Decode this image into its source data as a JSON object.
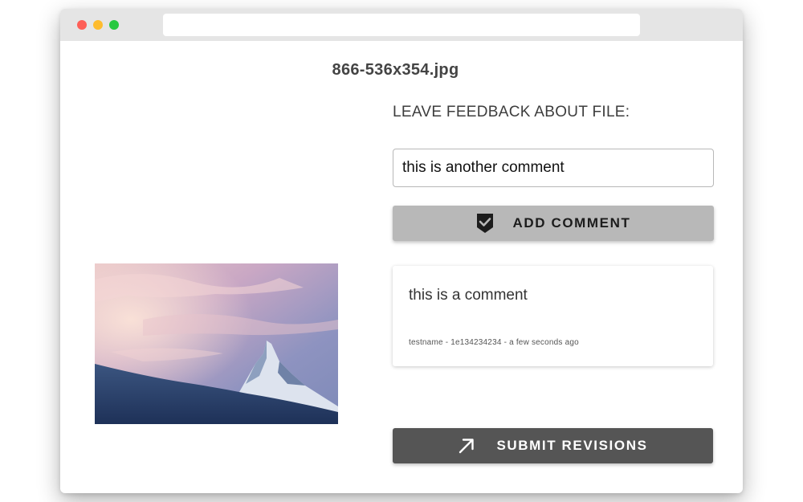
{
  "window": {
    "controls": [
      "close",
      "minimize",
      "zoom"
    ],
    "address_bar": ""
  },
  "file": {
    "title": "866-536x354.jpg",
    "preview_description": "mountain-peak-photo"
  },
  "feedback": {
    "label": "LEAVE FEEDBACK ABOUT FILE:",
    "input_value": "this is another comment",
    "add_button_label": "ADD COMMENT",
    "add_button_icon": "shield-check-icon"
  },
  "comments": [
    {
      "text": "this is a comment",
      "meta": "testname - 1e134234234 - a few seconds ago"
    }
  ],
  "submit": {
    "label": "SUBMIT REVISIONS",
    "icon": "arrow-up-right-icon"
  },
  "colors": {
    "titlebar": "#e5e5e5",
    "add_button_bg": "#b8b8b8",
    "submit_button_bg": "#555555",
    "close_dot": "#fe5f57",
    "minimize_dot": "#febc2e",
    "zoom_dot": "#28c840"
  }
}
